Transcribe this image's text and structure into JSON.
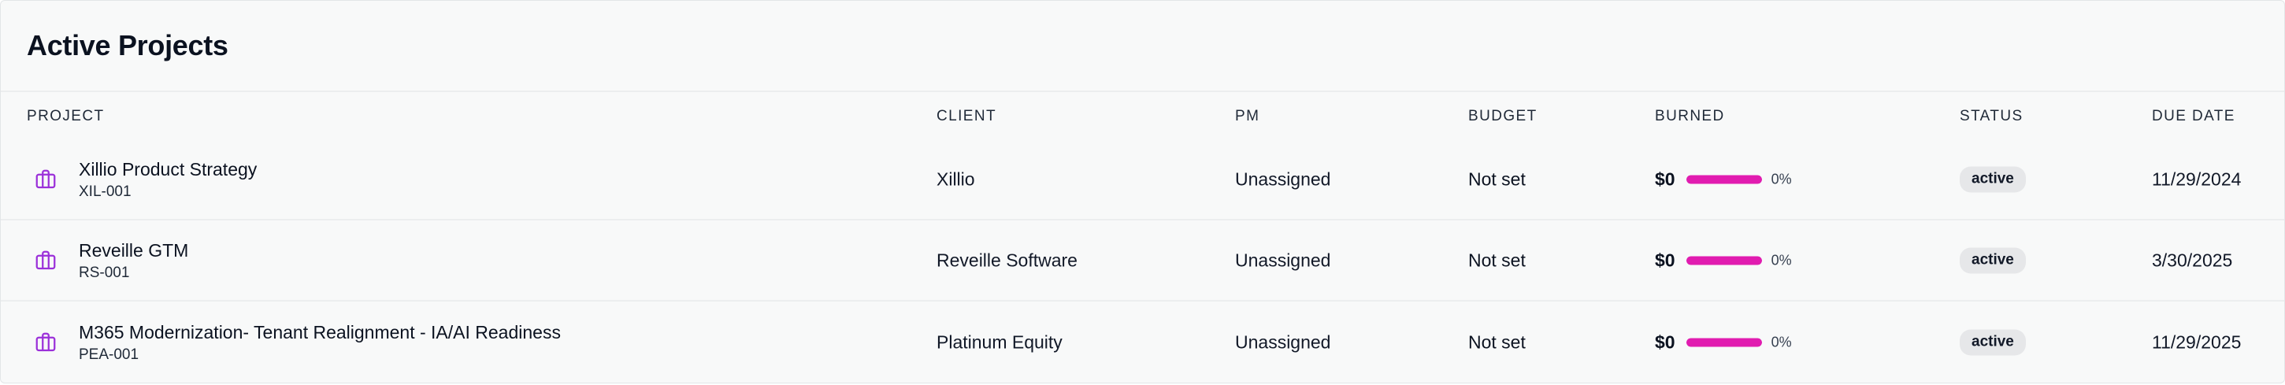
{
  "page": {
    "title": "Active Projects"
  },
  "table": {
    "headers": {
      "project": "PROJECT",
      "client": "CLIENT",
      "pm": "PM",
      "budget": "BUDGET",
      "burned": "BURNED",
      "status": "STATUS",
      "due_date": "DUE DATE"
    },
    "rows": [
      {
        "name": "Xillio Product Strategy",
        "code": "XIL-001",
        "client": "Xillio",
        "pm": "Unassigned",
        "budget": "Not set",
        "burned_amount": "$0",
        "burned_pct_label": "0%",
        "burn_fill_percent": 100,
        "status": "active",
        "due_date": "11/29/2024",
        "icon": "briefcase-icon"
      },
      {
        "name": "Reveille GTM",
        "code": "RS-001",
        "client": "Reveille Software",
        "pm": "Unassigned",
        "budget": "Not set",
        "burned_amount": "$0",
        "burned_pct_label": "0%",
        "burn_fill_percent": 100,
        "status": "active",
        "due_date": "3/30/2025",
        "icon": "briefcase-icon"
      },
      {
        "name": "M365 Modernization- Tenant Realignment - IA/AI Readiness",
        "code": "PEA-001",
        "client": "Platinum Equity",
        "pm": "Unassigned",
        "budget": "Not set",
        "burned_amount": "$0",
        "burned_pct_label": "0%",
        "burn_fill_percent": 100,
        "status": "active",
        "due_date": "11/29/2025",
        "icon": "briefcase-icon"
      }
    ]
  },
  "colors": {
    "accent_icon": "#9b30d9",
    "burn_fill": "#e11cb0",
    "badge_bg": "#e6e7e9"
  }
}
